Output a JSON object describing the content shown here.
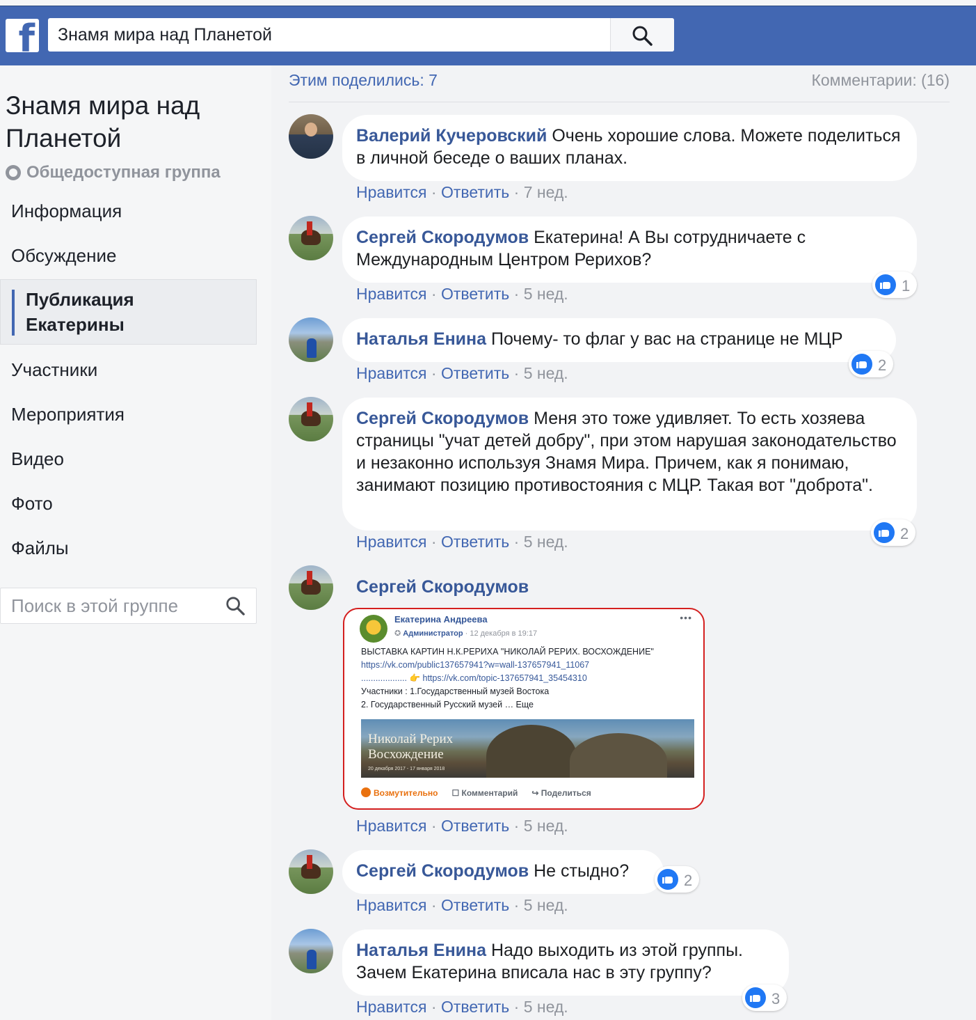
{
  "header": {
    "logo": "f",
    "search_value": "Знамя мира над Планетой"
  },
  "sidebar": {
    "group_title": "Знамя мира над Планетой",
    "privacy": "Общедоступная группа",
    "items": [
      {
        "label": "Информация"
      },
      {
        "label": "Обсуждение"
      },
      {
        "label": "Публикация Екатерины",
        "active": true
      },
      {
        "label": "Участники"
      },
      {
        "label": "Мероприятия"
      },
      {
        "label": "Видео"
      },
      {
        "label": "Фото"
      },
      {
        "label": "Файлы"
      }
    ],
    "search_placeholder": "Поиск в этой группе"
  },
  "post": {
    "shares": "Этим поделились: 7",
    "comments_count": "Комментарии: (16)"
  },
  "action_labels": {
    "like": "Нравится",
    "reply": "Ответить",
    "sep": " · "
  },
  "comments": [
    {
      "author": "Валерий Кучеровский",
      "text": "Очень хорошие слова. Можете поделиться в личной беседе о ваших планах.",
      "time": "7 нед.",
      "likes": ""
    },
    {
      "author": "Сергей Скородумов",
      "text": "Екатерина! А Вы сотрудничаете с Международным Центром Рерихов?",
      "time": "5 нед.",
      "likes": "1"
    },
    {
      "author": "Наталья Енина",
      "text": "Почему- то флаг у вас на странице не МЦР",
      "time": "5 нед.",
      "likes": "2"
    },
    {
      "author": "Сергей Скородумов",
      "text": "Меня это тоже удивляет. То есть хозяева страницы \"учат детей добру\", при этом нарушая законодательство и незаконно используя Знамя Мира. Причем, как я понимаю, занимают позицию противостояния с МЦР. Такая вот \"доброта\".",
      "time": "5 нед.",
      "likes": "2"
    },
    {
      "author": "Сергей Скородумов",
      "text": "",
      "time": "5 нед.",
      "likes": ""
    },
    {
      "author": "Сергей Скородумов",
      "text": "Не стыдно?",
      "time": "5 нед.",
      "likes": "2"
    },
    {
      "author": "Наталья Енина",
      "text": "Надо выходить из этой группы. Зачем Екатерина вписала нас в эту группу?",
      "time": "5 нед.",
      "likes": "3"
    }
  ],
  "attachment": {
    "author": "Екатерина Андреева",
    "role": "Администратор",
    "date": "· 12 декабря в 19:17",
    "more": "•••",
    "lines": [
      "ВЫСТАВКА КАРТИН Н.К.РЕРИХА \"НИКОЛАЙ РЕРИХ. ВОСХОЖДЕНИЕ\"",
      "https://vk.com/public137657941?w=wall-137657941_11067",
      "................... 👉 https://vk.com/topic-137657941_35454310",
      "Участники : 1.Государственный музей Востока",
      "2. Государственный Русский музей … Еще"
    ],
    "image_title_1": "Николай Рерих",
    "image_title_2": "Восхождение",
    "image_dates": "20 декабря 2017 - 17 января 2018",
    "reaction": "Возмутительно",
    "comment": "Комментарий",
    "share": "Поделиться"
  },
  "colors": {
    "brand": "#4267b2",
    "link": "#385898",
    "muted": "#90949c",
    "like": "#2078f4",
    "highlight": "#d41f1f"
  }
}
